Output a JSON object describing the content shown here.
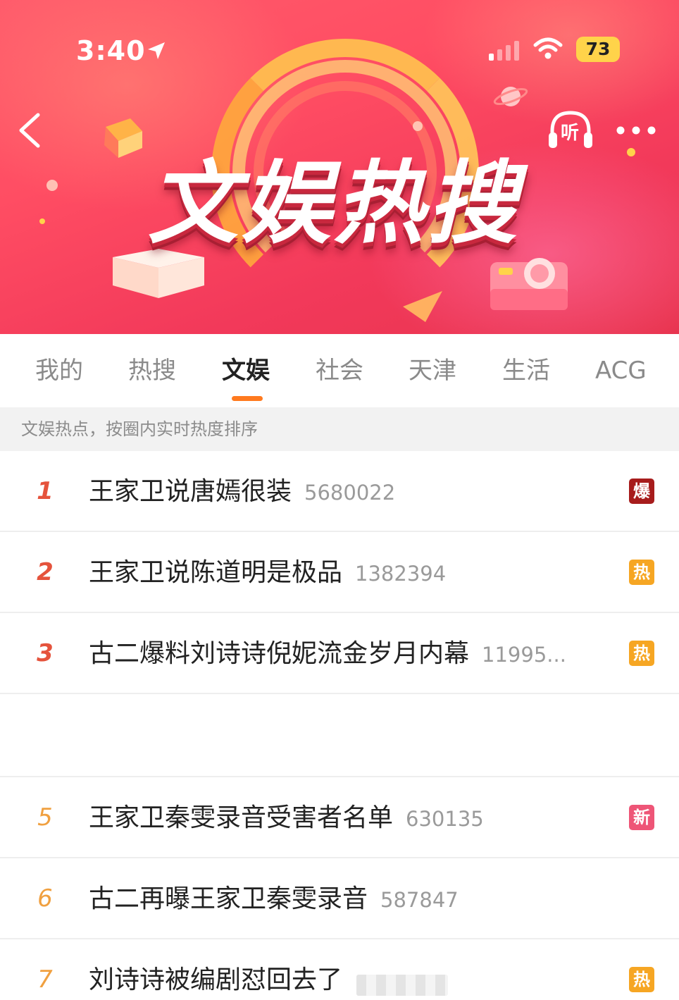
{
  "status_bar": {
    "time": "3:40",
    "battery": "73",
    "icons": [
      "location-arrow-icon",
      "signal-icon",
      "wifi-icon",
      "battery-icon"
    ]
  },
  "header": {
    "title": "文娱热搜",
    "listen_label": "听",
    "icons": [
      "back-chevron-icon",
      "headphones-icon",
      "more-dots-icon"
    ]
  },
  "tabs": [
    {
      "label": "我的",
      "active": false
    },
    {
      "label": "热搜",
      "active": false
    },
    {
      "label": "文娱",
      "active": true
    },
    {
      "label": "社会",
      "active": false
    },
    {
      "label": "天津",
      "active": false
    },
    {
      "label": "生活",
      "active": false
    },
    {
      "label": "ACG",
      "active": false
    }
  ],
  "subheader": "文娱热点，按圈内实时热度排序",
  "list": [
    {
      "rank": "1",
      "title": "王家卫说唐嫣很装",
      "count": "5680022",
      "badge": "爆"
    },
    {
      "rank": "2",
      "title": "王家卫说陈道明是极品",
      "count": "1382394",
      "badge": "热"
    },
    {
      "rank": "3",
      "title": "古二爆料刘诗诗倪妮流金岁月内幕",
      "count": "11995...",
      "badge": "热"
    },
    {
      "rank": "5",
      "title": "王家卫秦雯录音受害者名单",
      "count": "630135",
      "badge": "新"
    },
    {
      "rank": "6",
      "title": "古二再曝王家卫秦雯录音",
      "count": "587847",
      "badge": ""
    },
    {
      "rank": "7",
      "title": "刘诗诗被编剧怼回去了",
      "count": "",
      "badge": "热"
    }
  ],
  "colors": {
    "accent": "#ff7a1f",
    "banner": "#f2395a",
    "rank_top": "#e5533c",
    "rank_normal": "#f0a040",
    "badge_bao": "#a71c1c",
    "badge_re": "#f6a623",
    "badge_xin": "#ee5577"
  }
}
